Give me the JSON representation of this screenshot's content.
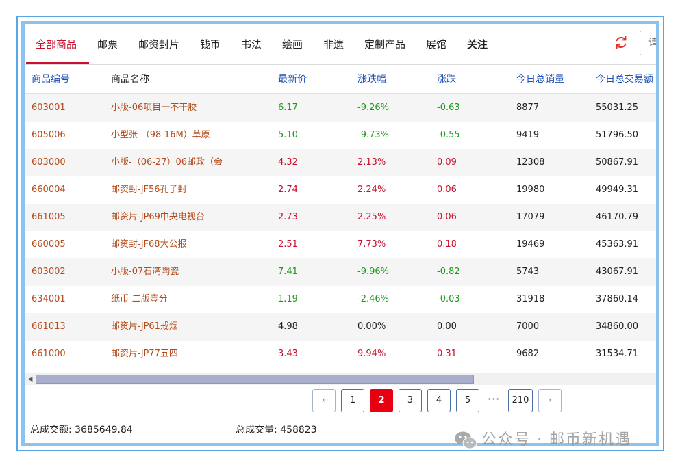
{
  "tabs": [
    {
      "label": "全部商品",
      "active": true
    },
    {
      "label": "邮票"
    },
    {
      "label": "邮资封片"
    },
    {
      "label": "钱币"
    },
    {
      "label": "书法"
    },
    {
      "label": "绘画"
    },
    {
      "label": "非遗"
    },
    {
      "label": "定制产品"
    },
    {
      "label": "展馆"
    },
    {
      "label": "关注",
      "bold": true
    }
  ],
  "search": {
    "placeholder": "请"
  },
  "icons": {
    "refresh": "refresh-icon",
    "scroll_left": "triangle-left-icon",
    "prev": "chevron-left-icon",
    "next": "chevron-right-icon",
    "watermark": "wechat-icon"
  },
  "table": {
    "headers": [
      "商品编号",
      "商品名称",
      "最新价",
      "涨跌幅",
      "涨跌",
      "今日总销量",
      "今日总交易额"
    ],
    "rows": [
      {
        "code": "603001",
        "name": "小版-06项目一不干胶",
        "price": "6.17",
        "pct": "-9.26%",
        "chg": "-0.63",
        "volume": "8877",
        "amount": "55031.25",
        "trend": "down"
      },
      {
        "code": "605006",
        "name": "小型张-（98-16M）草原",
        "price": "5.10",
        "pct": "-9.73%",
        "chg": "-0.55",
        "volume": "9419",
        "amount": "51796.50",
        "trend": "down"
      },
      {
        "code": "603000",
        "name": "小版-（06-27）06邮政（会",
        "price": "4.32",
        "pct": "2.13%",
        "chg": "0.09",
        "volume": "12308",
        "amount": "50867.91",
        "trend": "up"
      },
      {
        "code": "660004",
        "name": "邮资封-JF56孔子封",
        "price": "2.74",
        "pct": "2.24%",
        "chg": "0.06",
        "volume": "19980",
        "amount": "49949.31",
        "trend": "up"
      },
      {
        "code": "661005",
        "name": "邮资片-JP69中央电视台",
        "price": "2.73",
        "pct": "2.25%",
        "chg": "0.06",
        "volume": "17079",
        "amount": "46170.79",
        "trend": "up"
      },
      {
        "code": "660005",
        "name": "邮资封-JF68大公报",
        "price": "2.51",
        "pct": "7.73%",
        "chg": "0.18",
        "volume": "19469",
        "amount": "45363.91",
        "trend": "up"
      },
      {
        "code": "603002",
        "name": "小版-07石湾陶瓷",
        "price": "7.41",
        "pct": "-9.96%",
        "chg": "-0.82",
        "volume": "5743",
        "amount": "43067.91",
        "trend": "down"
      },
      {
        "code": "634001",
        "name": "纸币-二版壹分",
        "price": "1.19",
        "pct": "-2.46%",
        "chg": "-0.03",
        "volume": "31918",
        "amount": "37860.14",
        "trend": "down"
      },
      {
        "code": "661013",
        "name": "邮资片-JP61戒烟",
        "price": "4.98",
        "pct": "0.00%",
        "chg": "0.00",
        "volume": "7000",
        "amount": "34860.00",
        "trend": "flat"
      },
      {
        "code": "661000",
        "name": "邮资片-JP77五四",
        "price": "3.43",
        "pct": "9.94%",
        "chg": "0.31",
        "volume": "9682",
        "amount": "31534.71",
        "trend": "up"
      }
    ]
  },
  "pagination": {
    "prev": "‹",
    "pages": [
      "1",
      "2",
      "3",
      "4",
      "5"
    ],
    "current": "2",
    "ellipsis": "···",
    "last": "210",
    "next": "›"
  },
  "summary": {
    "total_amount_label": "总成交额:",
    "total_amount": "3685649.84",
    "total_volume_label": "总成交量:",
    "total_volume": "458823"
  },
  "watermark": "公众号 · 邮币新机遇",
  "colors": {
    "accent": "#c8102e",
    "up": "#c8102e",
    "down": "#1a9a1a",
    "header": "#1e4fb4",
    "frame": "#5aa6e2"
  }
}
